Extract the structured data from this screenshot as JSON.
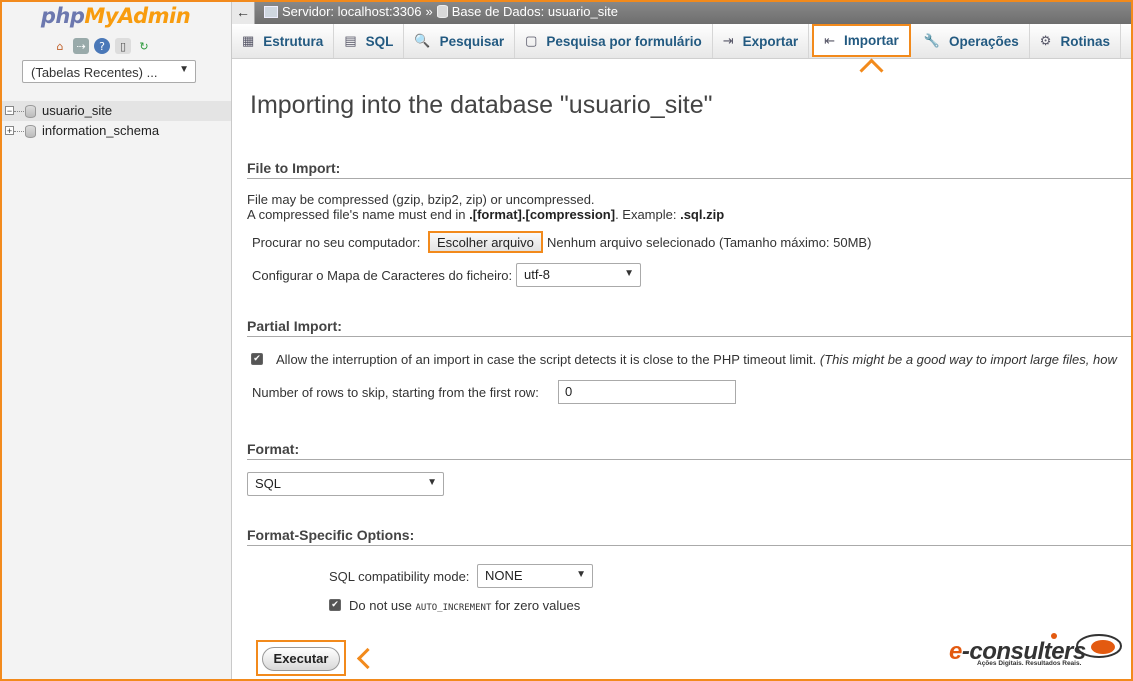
{
  "sidebar": {
    "logo": {
      "php": "php",
      "my": "My",
      "admin": "Admin"
    },
    "quick_icons": [
      "home-icon",
      "logout-icon",
      "help-icon",
      "docs-icon",
      "reload-icon"
    ],
    "recent_tables": "(Tabelas Recentes) ...",
    "tree": [
      {
        "label": "usuario_site",
        "toggle": "−"
      },
      {
        "label": "information_schema",
        "toggle": "+"
      }
    ]
  },
  "topbar": {
    "back": "←",
    "server": "Servidor: localhost:3306",
    "sep": "»",
    "database": "Base de Dados: usuario_site"
  },
  "tabs": [
    {
      "label": "Estrutura",
      "icon": "structure-icon",
      "glyph": "▦"
    },
    {
      "label": "SQL",
      "icon": "sql-icon",
      "glyph": "▤"
    },
    {
      "label": "Pesquisar",
      "icon": "search-icon",
      "glyph": "🔍"
    },
    {
      "label": "Pesquisa por formulário",
      "icon": "query-icon",
      "glyph": "▢"
    },
    {
      "label": "Exportar",
      "icon": "export-icon",
      "glyph": "⇥"
    },
    {
      "label": "Importar",
      "icon": "import-icon",
      "glyph": "⇤"
    },
    {
      "label": "Operações",
      "icon": "wrench-icon",
      "glyph": "🔧"
    },
    {
      "label": "Rotinas",
      "icon": "routines-icon",
      "glyph": "⚙"
    }
  ],
  "main": {
    "title": "Importing into the database \"usuario_site\"",
    "file_section": {
      "heading": "File to Import:",
      "line1": "File may be compressed (gzip, bzip2, zip) or uncompressed.",
      "line2_pre": "A compressed file's name must end in ",
      "line2_bold1": ".[format].[compression]",
      "line2_mid": ". Example: ",
      "line2_bold2": ".sql.zip",
      "browse_label": "Procurar no seu computador:",
      "browse_button": "Escolher arquivo",
      "browse_status": "Nenhum arquivo selecionado (Tamanho máximo: 50MB)",
      "charset_label": "Configurar o Mapa de Caracteres do ficheiro:",
      "charset_value": "utf-8"
    },
    "partial_section": {
      "heading": "Partial Import:",
      "allow_interrupt": "Allow the interruption of an import in case the script detects it is close to the PHP timeout limit.",
      "allow_interrupt_note": "(This might be a good way to import large files, how",
      "skip_label": "Number of rows to skip, starting from the first row:",
      "skip_value": "0"
    },
    "format_section": {
      "heading": "Format:",
      "value": "SQL"
    },
    "options_section": {
      "heading": "Format-Specific Options:",
      "compat_label": "SQL compatibility mode:",
      "compat_value": "NONE",
      "auto_inc_pre": "Do not use ",
      "auto_inc_code": "AUTO_INCREMENT",
      "auto_inc_post": " for zero values"
    },
    "execute_button": "Executar"
  },
  "brand": {
    "e": "e",
    "name": "-consulters",
    "tagline": "Ações Digitais. Resultados Reais."
  },
  "colors": {
    "highlight": "#f28a1c",
    "tab_text": "#235a81",
    "topbar": "#7a7a7a"
  }
}
